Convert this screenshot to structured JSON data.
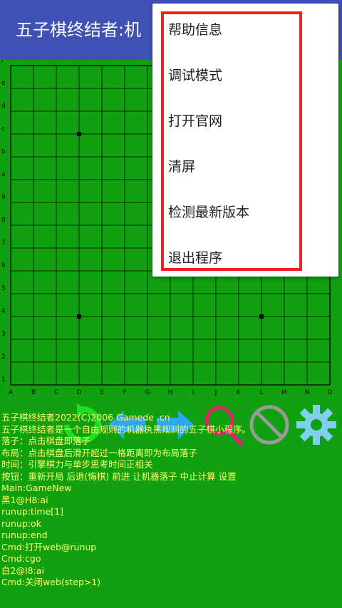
{
  "app": {
    "title": "五子棋终结者:机"
  },
  "board": {
    "col_labels": [
      "A",
      "B",
      "C",
      "D",
      "E",
      "F",
      "G",
      "H",
      "I",
      "J",
      "K",
      "L",
      "M",
      "N",
      "O"
    ],
    "row_labels": [
      "1",
      "2",
      "3",
      "4",
      "5",
      "6",
      "7",
      "8",
      "9",
      "a",
      "b",
      "c",
      "d",
      "e",
      "f"
    ],
    "stones": [
      {
        "col": "D",
        "row": "c"
      },
      {
        "col": "D",
        "row": "4"
      },
      {
        "col": "L",
        "row": "4"
      }
    ]
  },
  "controls": [
    {
      "name": "restart-icon",
      "color": "#22dd22"
    },
    {
      "name": "undo-icon",
      "color": "#2aa8f0"
    },
    {
      "name": "forward-icon",
      "color": "#2aa8f0"
    },
    {
      "name": "ai-move-icon",
      "color": "#e0226e"
    },
    {
      "name": "stop-icon",
      "color": "#9a9a9a"
    },
    {
      "name": "settings-gear-icon",
      "color": "#7fd0ef"
    }
  ],
  "log": [
    "五子棋终结者2022(C)2006 Gamede  .cn",
    "五子棋终结者是一个自由规则的机器执黑规则的五子棋小程序。",
    "落子：点击棋盘即落子",
    "布局：点击棋盘后滑开超过一格距离即为布局落子",
    "时间：引擎棋力与单步思考时间正相关",
    "按钮：重新开局  后退(悔棋)  前进  让机器落子  中止计算  设置",
    "Main:GameNew",
    "黑1@H8:ai",
    "runup:time[1]",
    "runup:ok",
    "runup:end",
    "Cmd:打开web@runup",
    "Cmd:cgo",
    "白2@I8:ai",
    "Cmd:关闭web(step>1)"
  ],
  "menu": {
    "items": [
      "帮助信息",
      "调试模式",
      "打开官网",
      "清屏",
      "检测最新版本",
      "退出程序"
    ],
    "highlight_color": "#ee2222"
  }
}
